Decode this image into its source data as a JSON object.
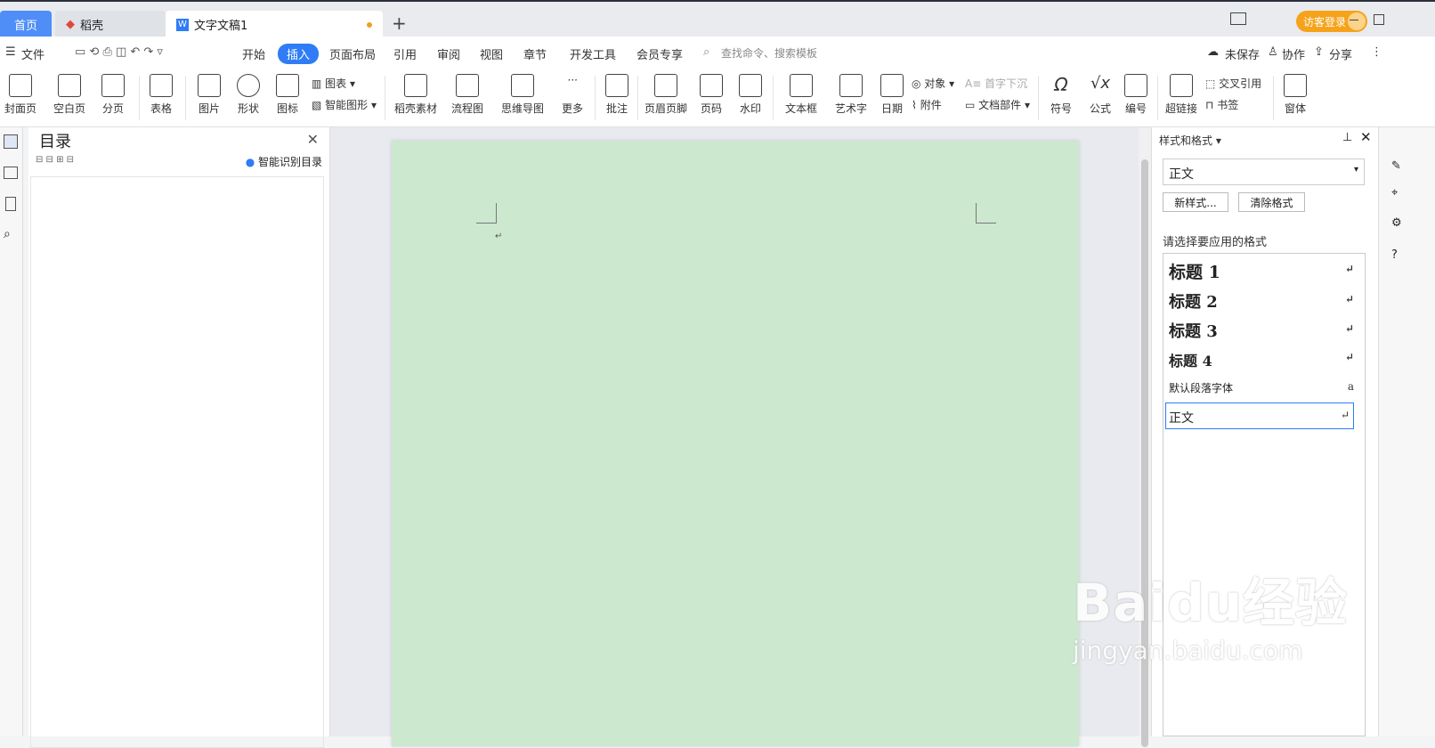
{
  "tabs": {
    "home": "首页",
    "daoke": "稻壳",
    "doc": "文字文稿1"
  },
  "login": "访客登录",
  "menu": {
    "file": "文件",
    "start": "开始",
    "insert": "插入",
    "layout": "页面布局",
    "reference": "引用",
    "review": "审阅",
    "view": "视图",
    "chapter": "章节",
    "devtools": "开发工具",
    "member": "会员专享",
    "search_placeholder": "查找命令、搜索模板",
    "unsaved": "未保存",
    "collab": "协作",
    "share": "分享"
  },
  "ribbon": {
    "cover": "封面页",
    "blank": "空白页",
    "pagebreak": "分页",
    "table": "表格",
    "picture": "图片",
    "shape": "形状",
    "icon": "图标",
    "chart": "图表",
    "smartart": "智能图形",
    "daoke_material": "稻壳素材",
    "flowchart": "流程图",
    "mindmap": "思维导图",
    "more": "更多",
    "comment": "批注",
    "header_footer": "页眉页脚",
    "page_number": "页码",
    "watermark": "水印",
    "textbox": "文本框",
    "wordart": "艺术字",
    "date": "日期",
    "object": "对象",
    "attachment": "附件",
    "dropcap": "首字下沉",
    "docpart": "文档部件",
    "symbol": "符号",
    "formula": "公式",
    "numbering": "编号",
    "hyperlink": "超链接",
    "crossref": "交叉引用",
    "bookmark": "书签",
    "window": "窗体"
  },
  "toc": {
    "title": "目录",
    "smart": "智能识别目录"
  },
  "stylepanel": {
    "title": "样式和格式",
    "current": "正文",
    "new_style": "新样式...",
    "clear": "清除格式",
    "hint": "请选择要应用的格式",
    "items": [
      {
        "label": "标题 1"
      },
      {
        "label": "标题 2"
      },
      {
        "label": "标题 3"
      },
      {
        "label": "标题 4"
      },
      {
        "label": "默认段落字体"
      },
      {
        "label": "正文"
      }
    ]
  },
  "watermark": {
    "brand": "Baidu经验",
    "url": "jingyan.baidu.com"
  },
  "colors": {
    "accent": "#2f7cf6",
    "page": "#cce8cf",
    "login": "#f6a31b"
  }
}
